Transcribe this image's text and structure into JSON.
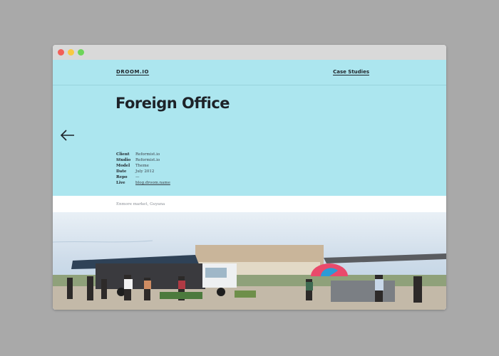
{
  "window": {
    "controls": [
      "close",
      "minimize",
      "maximize"
    ]
  },
  "nav": {
    "brand": "DROOM.IO",
    "link": "Case Studies"
  },
  "hero": {
    "title": "Foreign Office",
    "back_icon": "arrow-left-icon",
    "background": "#ace6ef"
  },
  "meta": [
    {
      "key": "Client",
      "value": "Reformist.io"
    },
    {
      "key": "Studio",
      "value": "Reformist.io"
    },
    {
      "key": "Model",
      "value": "Theme"
    },
    {
      "key": "Date",
      "value": "July 2012"
    },
    {
      "key": "Repo",
      "value": "—"
    },
    {
      "key": "Live",
      "value": "blog.droom.name"
    }
  ],
  "photo": {
    "caption": "Enmore market, Guyana"
  }
}
